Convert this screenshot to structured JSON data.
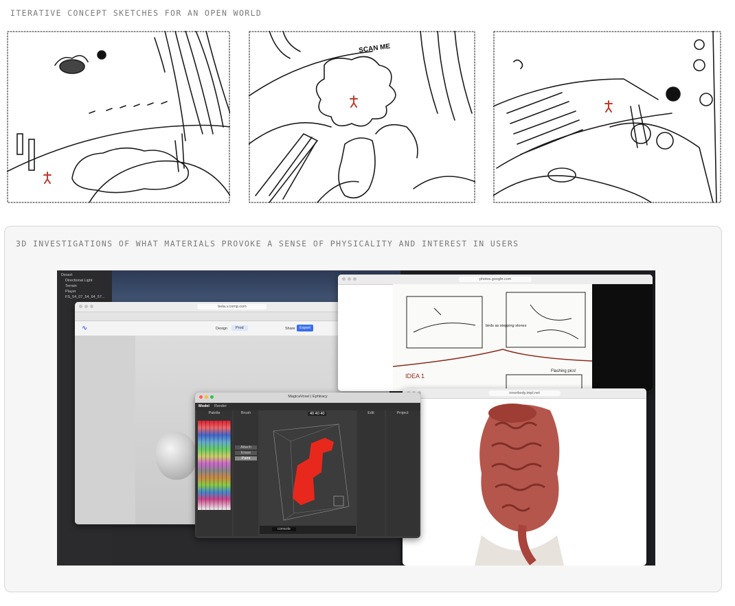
{
  "section1": {
    "caption": "ITERATIVE CONCEPT SKETCHES FOR AN OPEN WORLD"
  },
  "sketch_texts": {
    "scan": "SCAN ME"
  },
  "section2": {
    "caption": "3D INVESTIGATIONS OF WHAT MATERIALS PROVOKE A SENSE OF PHYSICALITY AND INTEREST IN USERS"
  },
  "windows": {
    "unity_hierarchy": [
      "Desert",
      "Directional Light",
      "Terrain",
      "Player",
      "FS_54_07_54_64_57..."
    ],
    "bezi_url": "beta.v.comp.com",
    "bezi_toolbar": [
      "Design",
      "Prod",
      "Share",
      "Export"
    ],
    "voxel_title": "MagicaVoxel | Ephtracy",
    "voxel_tabs": [
      "Model",
      "Render"
    ],
    "voxel_panels": [
      "Palette",
      "Brush",
      "Edit",
      "Project"
    ],
    "voxel_size": "40  40  40",
    "voxel_brush_modes": [
      "Attach",
      "Erase",
      "Paint"
    ],
    "voxel_console": "console",
    "photos_url": "photos.google.com",
    "photos_idea": "IDEA 1",
    "photos_note1": "birds as stepping stones",
    "photos_note2": "Flashing pics!",
    "body_url": "innerbody.impl.net"
  },
  "colors": {
    "accent_red": "#c0392b",
    "voxel_red": "#e8281c",
    "card_bg": "#f6f6f6"
  }
}
